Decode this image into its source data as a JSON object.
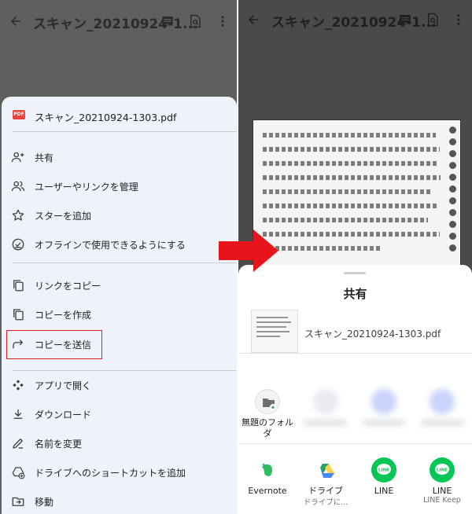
{
  "left": {
    "title": "スキャン_20210924-1...",
    "file": {
      "badge": "PDF",
      "name": "スキャン_20210924-1303.pdf"
    },
    "menu_group1": [
      {
        "label": "共有",
        "icon": "person-add-icon"
      },
      {
        "label": "ユーザーやリンクを管理",
        "icon": "people-icon"
      },
      {
        "label": "スターを追加",
        "icon": "star-icon"
      },
      {
        "label": "オフラインで使用できるようにする",
        "icon": "offline-icon"
      }
    ],
    "menu_group2": [
      {
        "label": "リンクをコピー",
        "icon": "copy-link-icon"
      },
      {
        "label": "コピーを作成",
        "icon": "copy-icon"
      },
      {
        "label": "コピーを送信",
        "icon": "send-copy-icon"
      }
    ],
    "menu_group3": [
      {
        "label": "アプリで開く",
        "icon": "open-with-icon"
      },
      {
        "label": "ダウンロード",
        "icon": "download-icon"
      },
      {
        "label": "名前を変更",
        "icon": "edit-icon"
      },
      {
        "label": "ドライブへのショートカットを追加",
        "icon": "add-shortcut-icon"
      },
      {
        "label": "移動",
        "icon": "move-icon"
      }
    ]
  },
  "right": {
    "title": "スキャン_20210924-1...",
    "share": {
      "title": "共有",
      "file_name": "スキャン_20210924-1303.pdf",
      "folder_app": {
        "name": "無題のフォルダ"
      },
      "apps": [
        {
          "name": "Evernote",
          "sub": ""
        },
        {
          "name": "ドライブ",
          "sub": "ドライブに..."
        },
        {
          "name": "LINE",
          "sub": ""
        },
        {
          "name": "LINE",
          "sub": "LINE Keep"
        }
      ]
    }
  },
  "colors": {
    "highlight": "#e02020",
    "arrow": "#e8141c",
    "sheet": "#eef2fa"
  }
}
